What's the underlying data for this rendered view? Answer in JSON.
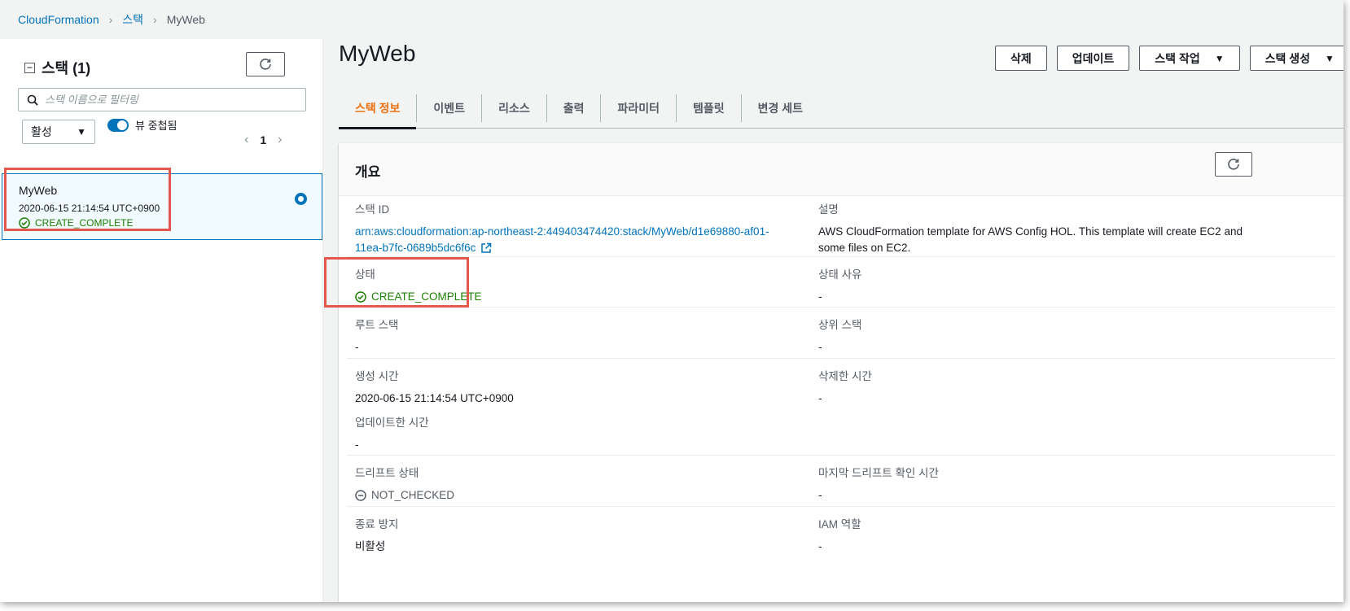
{
  "breadcrumb": {
    "root": "CloudFormation",
    "stacks": "스택",
    "current": "MyWeb"
  },
  "left_panel": {
    "title": "스택 (1)",
    "search_placeholder": "스택 이름으로 필터링",
    "filter_select": "활성",
    "nested_toggle_label": "뷰 중첩됨",
    "page_number": "1",
    "stacks": [
      {
        "name": "MyWeb",
        "time": "2020-06-15 21:14:54 UTC+0900",
        "status": "CREATE_COMPLETE"
      }
    ]
  },
  "main": {
    "title": "MyWeb",
    "actions": {
      "delete": "삭제",
      "update": "업데이트",
      "stack_actions": "스택 작업",
      "create_stack": "스택 생성"
    },
    "tabs": [
      "스택 정보",
      "이벤트",
      "리소스",
      "출력",
      "파라미터",
      "템플릿",
      "변경 세트"
    ],
    "overview": {
      "title": "개요",
      "stack_id_label": "스택 ID",
      "stack_id_line1": "arn:aws:cloudformation:ap-northeast-2:449403474420:stack/MyWeb/d1e69880-af01-",
      "stack_id_line2": "11ea-b7fc-0689b5dc6f6c",
      "description_label": "설명",
      "description_line1": "AWS CloudFormation template for AWS Config HOL. This template will create EC2 and",
      "description_line2": "some files on EC2.",
      "status_label": "상태",
      "status_value": "CREATE_COMPLETE",
      "status_reason_label": "상태 사유",
      "status_reason_value": "-",
      "root_stack_label": "루트 스택",
      "root_stack_value": "-",
      "parent_stack_label": "상위 스택",
      "parent_stack_value": "-",
      "created_label": "생성 시간",
      "created_value": "2020-06-15 21:14:54 UTC+0900",
      "deleted_label": "삭제한 시간",
      "deleted_value": "-",
      "updated_label": "업데이트한 시간",
      "updated_value": "-",
      "drift_label": "드리프트 상태",
      "drift_value": "NOT_CHECKED",
      "last_drift_label": "마지막 드리프트 확인 시간",
      "last_drift_value": "-",
      "termination_label": "종료 방지",
      "termination_value": "비활성",
      "iam_label": "IAM 역할",
      "iam_value": "-"
    }
  },
  "colors": {
    "link": "#0073bb",
    "success": "#1d8102",
    "highlight": "#e4574c",
    "tab_active": "#ec7211"
  }
}
